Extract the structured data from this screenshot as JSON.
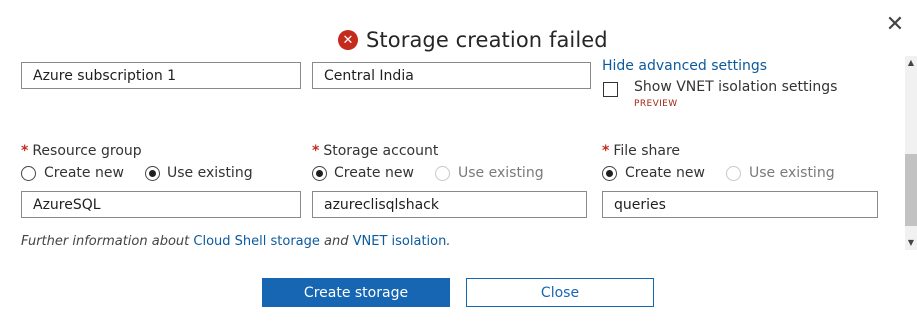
{
  "dialog": {
    "title": "Storage creation failed",
    "close_glyph": "✕",
    "error_glyph": "✕"
  },
  "top_row": {
    "subscription_value": "Azure subscription 1",
    "region_value": "Central India"
  },
  "advanced": {
    "hide_link": "Hide advanced settings",
    "vnet_checkbox_label": "Show VNET isolation settings",
    "vnet_checked": false,
    "preview_badge": "PREVIEW"
  },
  "resource_group": {
    "required_mark": "*",
    "label": "Resource group",
    "options": [
      "Create new",
      "Use existing"
    ],
    "selected": "Use existing",
    "value": "AzureSQL"
  },
  "storage_account": {
    "required_mark": "*",
    "label": "Storage account",
    "options": [
      "Create new",
      "Use existing"
    ],
    "selected": "Create new",
    "value": "azureclisqlshack"
  },
  "file_share": {
    "required_mark": "*",
    "label": "File share",
    "options": [
      "Create new",
      "Use existing"
    ],
    "selected": "Create new",
    "value": "queries"
  },
  "info": {
    "prefix": "Further information about ",
    "link1": "Cloud Shell storage",
    "middle": " and ",
    "link2": "VNET isolation",
    "suffix": "."
  },
  "buttons": {
    "create": "Create storage",
    "close": "Close"
  },
  "scrollbar": {
    "up_glyph": "▲",
    "down_glyph": "▼"
  },
  "colors": {
    "error": "#c42b1c",
    "link": "#0a5a9e",
    "primary": "#1766b4",
    "preview": "#a0271c"
  }
}
